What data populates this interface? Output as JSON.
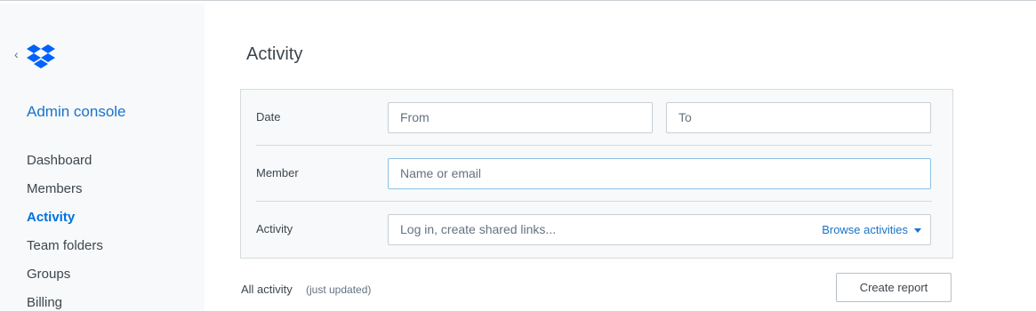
{
  "sidebar": {
    "title": "Admin console",
    "nav": [
      {
        "label": "Dashboard",
        "active": false
      },
      {
        "label": "Members",
        "active": false
      },
      {
        "label": "Activity",
        "active": true
      },
      {
        "label": "Team folders",
        "active": false
      },
      {
        "label": "Groups",
        "active": false
      },
      {
        "label": "Billing",
        "active": false
      }
    ]
  },
  "main": {
    "title": "Activity",
    "filters": {
      "date_label": "Date",
      "from_placeholder": "From",
      "to_placeholder": "To",
      "member_label": "Member",
      "member_placeholder": "Name or email",
      "activity_label": "Activity",
      "activity_placeholder": "Log in, create shared links...",
      "browse_label": "Browse activities"
    },
    "results_label": "All activity",
    "results_status": "(just updated)",
    "create_report_label": "Create report"
  },
  "colors": {
    "accent": "#1a73c9",
    "brand_logo": "#0061fe",
    "sidebar_bg": "#f7f9fa"
  },
  "icons": [
    "back-chevron-icon",
    "dropbox-logo-icon",
    "caret-down-icon"
  ]
}
